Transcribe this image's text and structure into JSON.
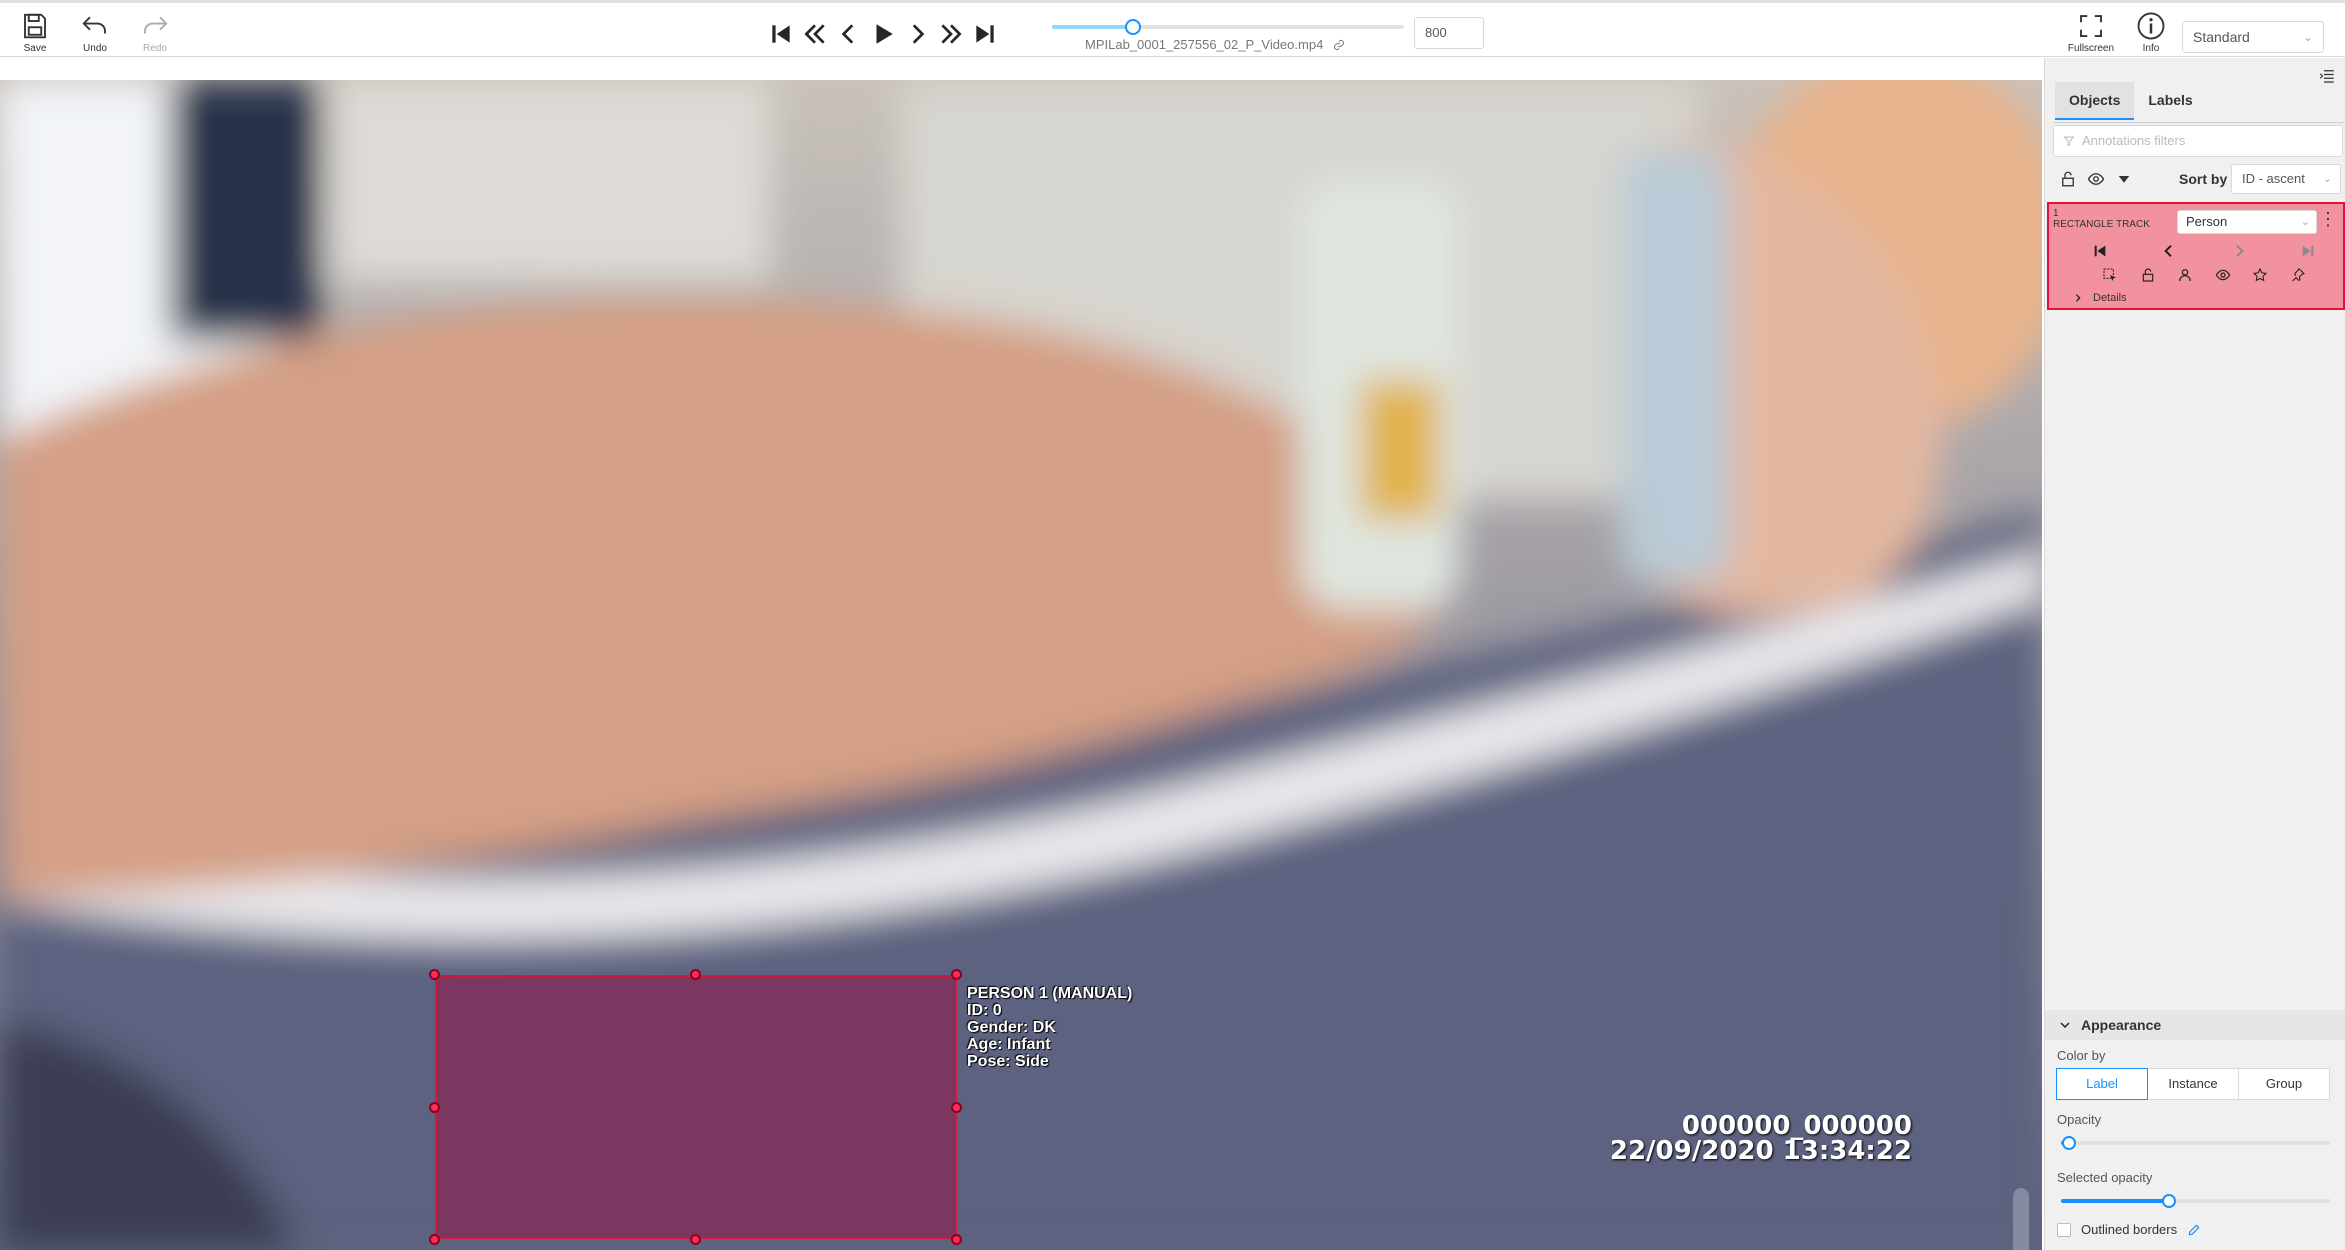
{
  "toolbar": {
    "save_label": "Save",
    "undo_label": "Undo",
    "redo_label": "Redo",
    "fullscreen_label": "Fullscreen",
    "info_label": "Info",
    "workspace": "Standard"
  },
  "player": {
    "filename": "MPILab_0001_257556_02_P_Video.mp4",
    "frame": "800",
    "progress_fraction": 0.23
  },
  "canvas": {
    "object_text": [
      "PERSON 1 (MANUAL)",
      "ID: 0",
      "Gender: DK",
      "Age: Infant",
      "Pose: Side"
    ],
    "stamp_line1": "000000_000000",
    "stamp_line2": "22/09/2020 13:34:22"
  },
  "sidebar": {
    "tabs": [
      "Objects",
      "Labels"
    ],
    "filter_placeholder": "Annotations filters",
    "sort_label": "Sort by",
    "sort_value": "ID - ascent",
    "object": {
      "id": "1",
      "type": "RECTANGLE TRACK",
      "label": "Person",
      "details": "Details",
      "color": "#f3929f"
    },
    "appearance": {
      "title": "Appearance",
      "color_by_label": "Color by",
      "color_by_options": [
        "Label",
        "Instance",
        "Group"
      ],
      "color_by_selected": "Label",
      "opacity_label": "Opacity",
      "opacity_fraction": 0.03,
      "selected_opacity_label": "Selected opacity",
      "selected_opacity_fraction": 0.4,
      "outlined_label": "Outlined borders"
    }
  }
}
